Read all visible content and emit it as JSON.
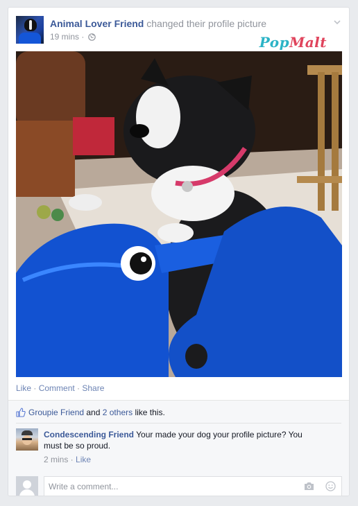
{
  "post": {
    "author": "Animal Lover Friend",
    "action": "changed their profile picture",
    "time": "19 mins",
    "separator": " · ",
    "privacy_icon": "globe-icon",
    "menu_icon": "chevron-down-icon",
    "watermark_part1": "Pop",
    "watermark_part2": "Malt"
  },
  "actions": {
    "like": "Like",
    "comment": "Comment",
    "share": "Share",
    "dot": " · "
  },
  "likes": {
    "name": "Groupie Friend",
    "and": " and ",
    "others": "2 others",
    "suffix": " like this.",
    "icon": "thumbs-up-icon"
  },
  "comment": {
    "author": "Condescending Friend",
    "text": "Your made your dog your profile picture? You must be so proud.",
    "time": "2 mins",
    "dot": " · ",
    "like": "Like"
  },
  "composer": {
    "placeholder": "Write a comment...",
    "icons": [
      "camera-icon",
      "emoji-icon"
    ]
  },
  "colors": {
    "link": "#3b5998",
    "muted": "#90949c",
    "watermark_teal": "#2bb3c6",
    "watermark_red": "#e0445c"
  }
}
